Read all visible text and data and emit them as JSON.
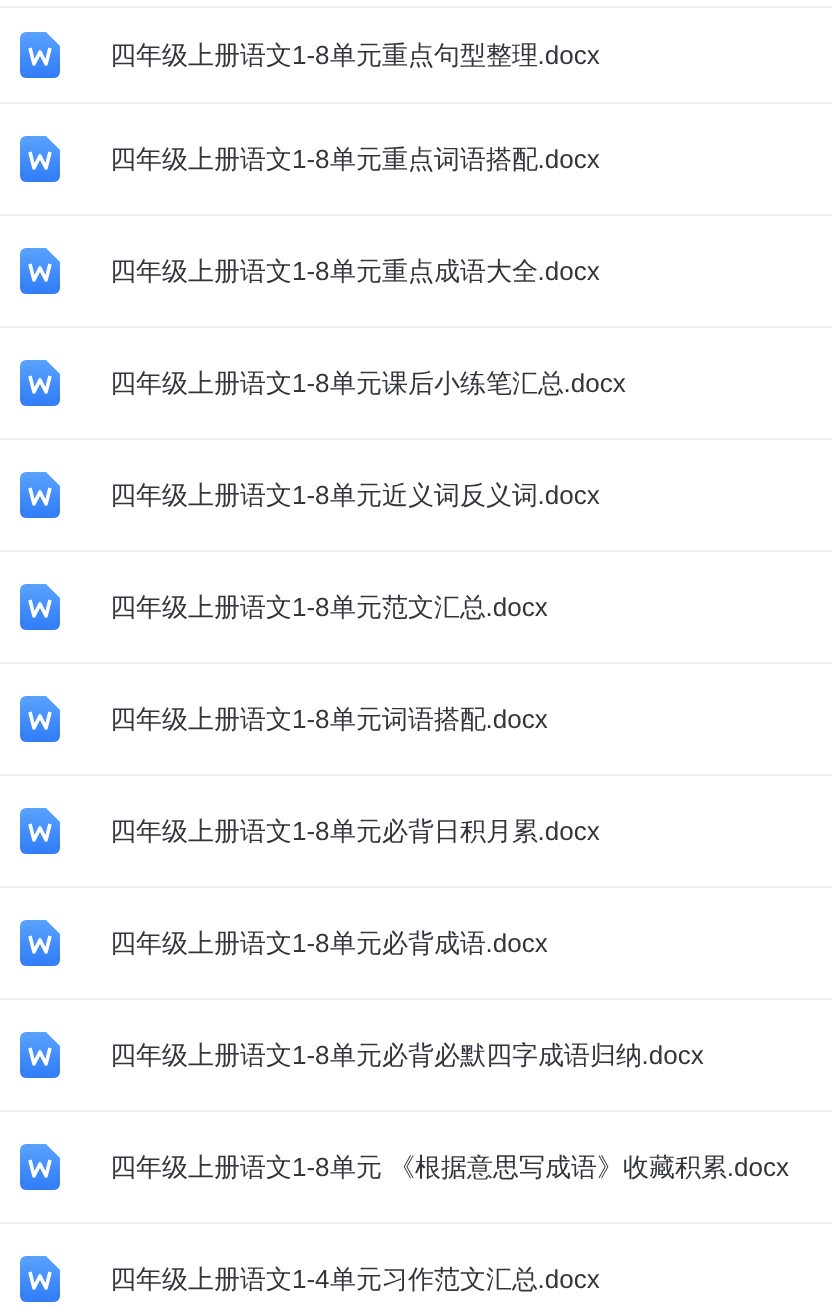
{
  "files": [
    {
      "name": "四年级上册语文1-8单元重点句型整理.docx"
    },
    {
      "name": "四年级上册语文1-8单元重点词语搭配.docx"
    },
    {
      "name": "四年级上册语文1-8单元重点成语大全.docx"
    },
    {
      "name": "四年级上册语文1-8单元课后小练笔汇总.docx"
    },
    {
      "name": "四年级上册语文1-8单元近义词反义词.docx"
    },
    {
      "name": "四年级上册语文1-8单元范文汇总.docx"
    },
    {
      "name": "四年级上册语文1-8单元词语搭配.docx"
    },
    {
      "name": "四年级上册语文1-8单元必背日积月累.docx"
    },
    {
      "name": "四年级上册语文1-8单元必背成语.docx"
    },
    {
      "name": "四年级上册语文1-8单元必背必默四字成语归纳.docx"
    },
    {
      "name": "四年级上册语文1-8单元 《根据意思写成语》收藏积累.docx"
    },
    {
      "name": "四年级上册语文1-4单元习作范文汇总.docx"
    }
  ]
}
